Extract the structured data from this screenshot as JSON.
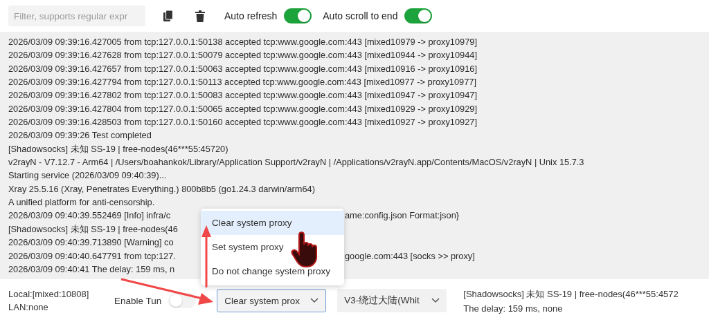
{
  "toolbar": {
    "filter": {
      "placeholder": "Filter, supports regular expr"
    },
    "toggles": [
      {
        "label": "Auto refresh",
        "on": true
      },
      {
        "label": "Auto scroll to end",
        "on": true
      }
    ]
  },
  "log": {
    "lines": [
      {
        "text": "2026/03/09 09:39:16.427005 from tcp:127.0.0.1:50138 accepted tcp:www.google.com:443 [mixed10979 -> proxy10979]"
      },
      {
        "text": "2026/03/09 09:39:16.427628 from tcp:127.0.0.1:50079 accepted tcp:www.google.com:443 [mixed10944 -> proxy10944]"
      },
      {
        "text": "2026/03/09 09:39:16.427657 from tcp:127.0.0.1:50063 accepted tcp:www.google.com:443 [mixed10916 -> proxy10916]"
      },
      {
        "text": "2026/03/09 09:39:16.427794 from tcp:127.0.0.1:50113 accepted tcp:www.google.com:443 [mixed10977 -> proxy10977]"
      },
      {
        "text": "2026/03/09 09:39:16.427802 from tcp:127.0.0.1:50083 accepted tcp:www.google.com:443 [mixed10947 -> proxy10947]"
      },
      {
        "text": "2026/03/09 09:39:16.427804 from tcp:127.0.0.1:50065 accepted tcp:www.google.com:443 [mixed10929 -> proxy10929]"
      },
      {
        "text": "2026/03/09 09:39:16.428503 from tcp:127.0.0.1:50160 accepted tcp:www.google.com:443 [mixed10927 -> proxy10927]"
      },
      {
        "text": "2026/03/09 09:39:26 Test completed"
      },
      {
        "text": "[Shadowsocks] 未知 SS-19 | free-nodes(46***55:45720)"
      },
      {
        "text": "v2rayN - V7.12.7 - Arm64 | /Users/boahankok/Library/Application Support/v2rayN | /Applications/v2rayN.app/Contents/MacOS/v2rayN | Unix 15.7.3"
      },
      {
        "text": "Starting service (2026/03/09 09:40:39)..."
      },
      {
        "text": "Xray 25.5.16 (Xray, Penetrates Everything.) 800b8b5 (go1.24.3 darwin/arm64)"
      },
      {
        "text": "A unified platform for anti-censorship."
      },
      {
        "text": "2026/03/09 09:40:39.552469 [Info] infra/c",
        "tail": "ame:config.json Format:json}"
      },
      {
        "text": "[Shadowsocks] 未知 SS-19 | free-nodes(46"
      },
      {
        "text": "2026/03/09 09:40:39.713890 [Warning] co"
      },
      {
        "text": "2026/03/09 09:40:40.647791 from tcp:127.",
        "tail": "google.com:443 [socks >> proxy]"
      },
      {
        "text": "2026/03/09 09:40:41 The delay: 159 ms, n"
      }
    ]
  },
  "menu": {
    "items": [
      {
        "label": "Clear system proxy",
        "selected": true
      },
      {
        "label": "Set system proxy",
        "selected": false
      },
      {
        "label": "Do not change system proxy",
        "selected": false
      }
    ]
  },
  "status_bar": {
    "local": "Local:[mixed:10808]",
    "lan": "LAN:none",
    "tun": {
      "label": "Enable Tun",
      "on": false
    },
    "proxy_mode": "Clear system prox",
    "routing": "V3-绕过大陆(Whit",
    "server": "[Shadowsocks] 未知 SS-19 | free-nodes(46***55:4572",
    "delay": "The delay: 159 ms, none"
  }
}
